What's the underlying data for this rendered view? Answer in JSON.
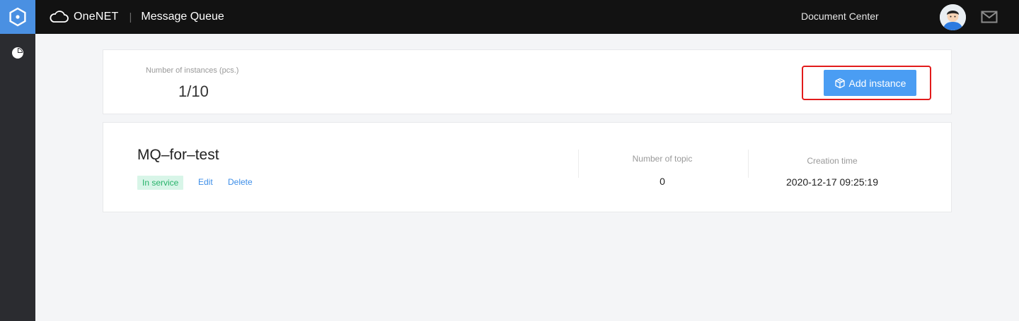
{
  "header": {
    "brand_name": "OneNET",
    "separator": "|",
    "section_title": "Message Queue",
    "doc_center_label": "Document Center"
  },
  "summary": {
    "label": "Number of instances (pcs.)",
    "value": "1/10",
    "add_button_label": "Add instance"
  },
  "instance": {
    "name": "MQ–for–test",
    "status": "In service",
    "edit_label": "Edit",
    "delete_label": "Delete",
    "topics_label": "Number of topic",
    "topics_value": "0",
    "created_label": "Creation time",
    "created_value": "2020-12-17 09:25:19"
  },
  "colors": {
    "accent": "#4a9df3",
    "highlight_border": "#e21b1b",
    "status_bg": "#d8f5e8",
    "status_text": "#27b36a",
    "header_bg": "#121212",
    "sidebar_bg": "#2b2c30"
  },
  "icons": [
    "hexagon-logo-icon",
    "cloud-logo-icon",
    "pie-chart-icon",
    "avatar",
    "mail-icon",
    "package-icon"
  ]
}
